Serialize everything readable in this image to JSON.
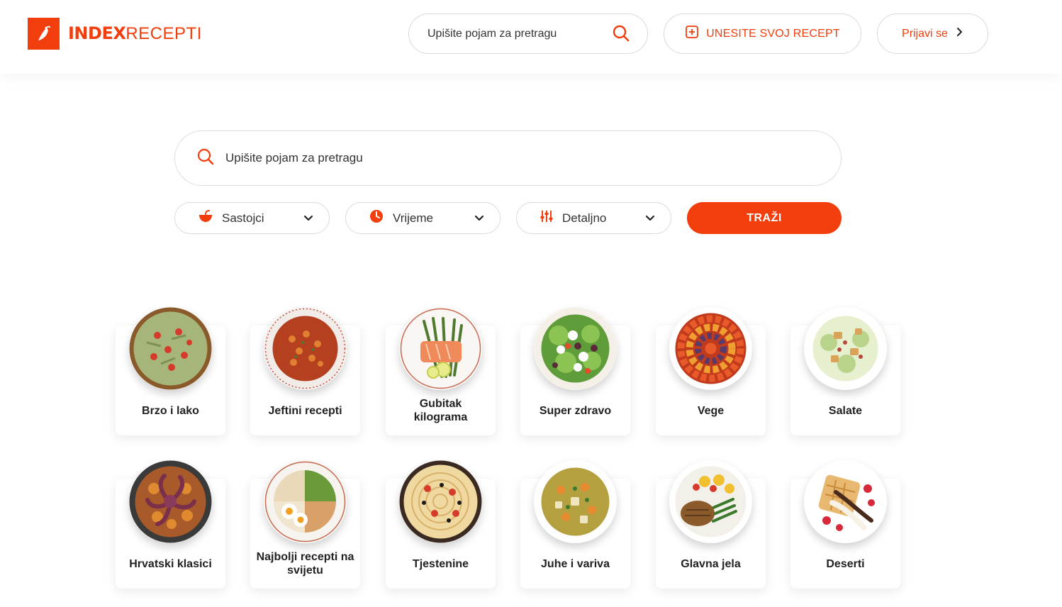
{
  "brand": {
    "part1": "INDEX",
    "part2": "RECEPTI",
    "color": "#f23d0d"
  },
  "header": {
    "search_placeholder": "Upišite pojam za pretragu",
    "add_recipe_label": "UNESITE SVOJ RECEPT",
    "login_label": "Prijavi se"
  },
  "search": {
    "placeholder": "Upišite pojam za pretragu",
    "filters": [
      {
        "label": "Sastojci",
        "icon": "bowl-icon"
      },
      {
        "label": "Vrijeme",
        "icon": "clock-icon"
      },
      {
        "label": "Detaljno",
        "icon": "sliders-icon"
      }
    ],
    "submit_label": "TRAŽI"
  },
  "categories": [
    {
      "label": "Brzo i lako"
    },
    {
      "label": "Jeftini recepti"
    },
    {
      "label": "Gubitak kilograma"
    },
    {
      "label": "Super zdravo"
    },
    {
      "label": "Vege"
    },
    {
      "label": "Salate"
    },
    {
      "label": "Hrvatski klasici"
    },
    {
      "label": "Najbolji recepti na svijetu"
    },
    {
      "label": "Tjestenine"
    },
    {
      "label": "Juhe i variva"
    },
    {
      "label": "Glavna jela"
    },
    {
      "label": "Deserti"
    }
  ]
}
